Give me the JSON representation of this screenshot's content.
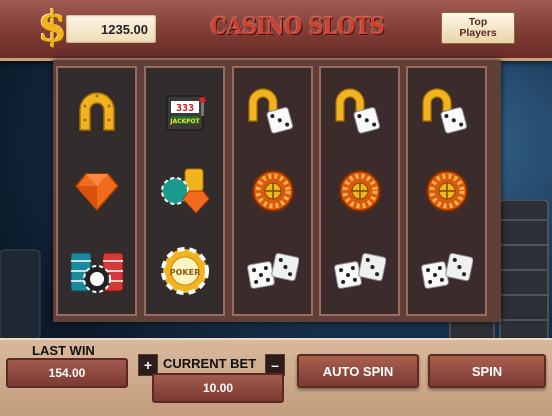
{
  "header": {
    "currency_symbol": "$",
    "balance": "1235.00",
    "title": "CASINO SLOTS",
    "top_players_line1": "Top",
    "top_players_line2": "Players"
  },
  "reels": [
    [
      "horseshoe-icon",
      "diamond-icon",
      "poker-chips-icon"
    ],
    [
      "slot-machine-jackpot-icon",
      "chips-diamond-icon",
      "poker-chip-icon"
    ],
    [
      "horseshoe-dice-icon",
      "roulette-wheel-icon",
      "dice-icon"
    ],
    [
      "horseshoe-dice-icon",
      "roulette-wheel-icon",
      "dice-icon"
    ],
    [
      "horseshoe-dice-icon",
      "roulette-wheel-icon",
      "dice-icon"
    ]
  ],
  "slot_text": {
    "jackpot_digits": "333",
    "jackpot_label": "JACKPOT",
    "chip_label": "POKER"
  },
  "footer": {
    "last_win_label": "LAST WIN",
    "last_win_value": "154.00",
    "plus_label": "+",
    "minus_label": "–",
    "current_bet_label": "CURRENT BET",
    "current_bet_value": "10.00",
    "auto_spin_label": "AUTO SPIN",
    "spin_label": "SPIN"
  },
  "colors": {
    "gold": "#f2b321",
    "title_red": "#d13e32",
    "panel_brown": "#7d3a33"
  }
}
